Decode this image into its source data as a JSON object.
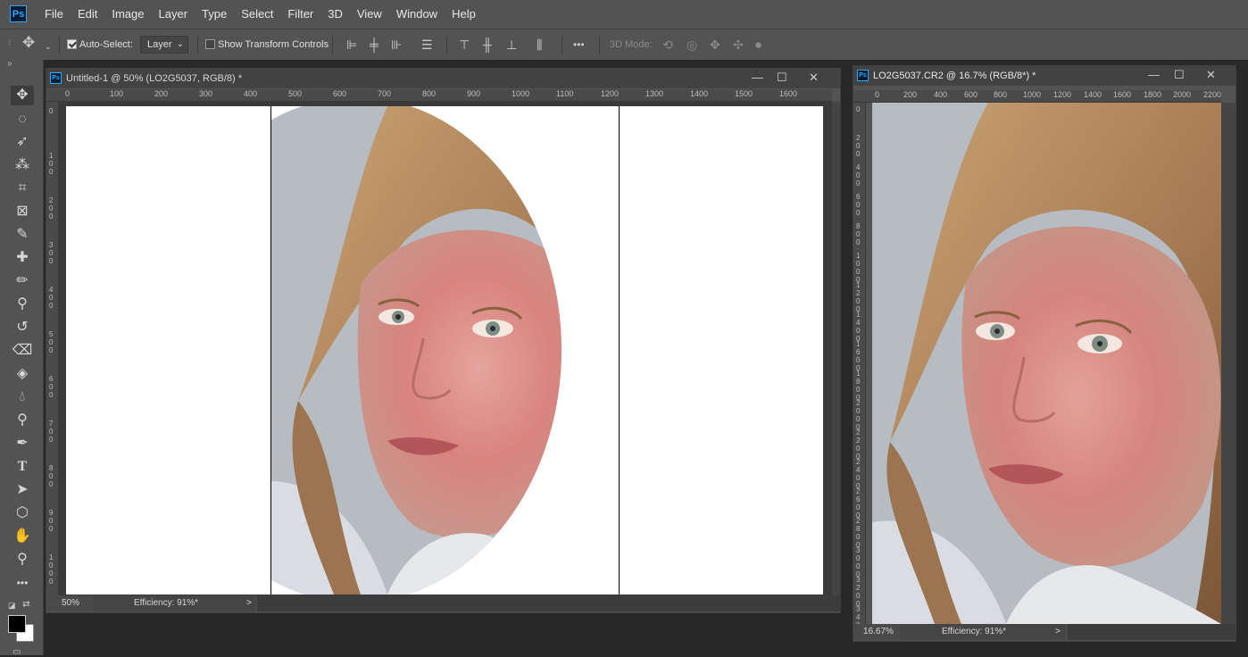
{
  "menubar": {
    "logo": "Ps",
    "items": [
      "File",
      "Edit",
      "Image",
      "Layer",
      "Type",
      "Select",
      "Filter",
      "3D",
      "View",
      "Window",
      "Help"
    ]
  },
  "options": {
    "auto_select_label": "Auto-Select:",
    "auto_select_checked": true,
    "layer_dropdown_value": "Layer",
    "show_transform_label": "Show Transform Controls",
    "show_transform_checked": false,
    "three_d_mode_label": "3D Mode:",
    "more_label": "•••"
  },
  "toolbar": {
    "collapse_label": "»",
    "tools": [
      "move-tool",
      "marquee-tool",
      "lasso-tool",
      "magic-wand-tool",
      "crop-tool",
      "frame-tool",
      "eyedropper-tool",
      "healing-brush-tool",
      "brush-tool",
      "clone-stamp-tool",
      "history-brush-tool",
      "eraser-tool",
      "paint-bucket-tool",
      "blur-tool",
      "dodge-tool",
      "pen-tool",
      "type-tool",
      "path-selection-tool",
      "shape-tool",
      "hand-tool",
      "zoom-tool",
      "edit-toolbar"
    ],
    "foreground_color": "#000000",
    "background_color": "#ffffff"
  },
  "doc1": {
    "title": "Untitled-1 @ 50% (LO2G5037, RGB/8) *",
    "ruler_h": [
      "0",
      "100",
      "200",
      "300",
      "400",
      "500",
      "600",
      "700",
      "800",
      "900",
      "1000",
      "1100",
      "1200",
      "1300",
      "1400",
      "1500",
      "1600"
    ],
    "ruler_v": [
      "0",
      "100",
      "200",
      "300",
      "400",
      "500",
      "600",
      "700",
      "800",
      "900",
      "1000"
    ],
    "zoom": "50%",
    "efficiency": "Efficiency: 91%*",
    "status_arrow": ">"
  },
  "doc2": {
    "title": "LO2G5037.CR2 @ 16.7% (RGB/8*) *",
    "ruler_h": [
      "0",
      "200",
      "400",
      "600",
      "800",
      "1000",
      "1200",
      "1400",
      "1600",
      "1800",
      "2000",
      "2200"
    ],
    "ruler_v": [
      "0",
      "200",
      "400",
      "600",
      "800",
      "1000",
      "1200",
      "1400",
      "1600",
      "1800",
      "2000",
      "2200",
      "2400",
      "2600",
      "2800",
      "3000",
      "3200",
      "3400"
    ],
    "zoom": "16.67%",
    "efficiency": "Efficiency: 91%*",
    "status_arrow": ">"
  },
  "colors": {
    "app_bg": "#282828",
    "panel": "#535353",
    "accent": "#31a8ff"
  }
}
